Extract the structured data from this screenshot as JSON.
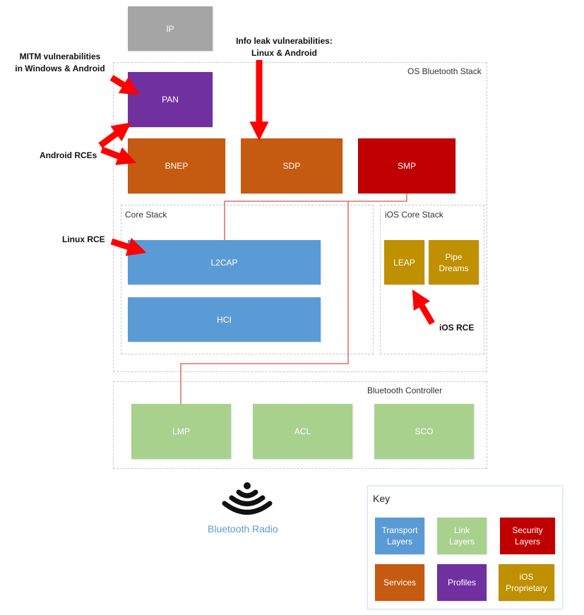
{
  "colors": {
    "transport": "#5b9bd5",
    "link": "#a9d18e",
    "security": "#c00000",
    "services": "#c55a11",
    "profiles": "#7030a0",
    "ios": "#bf9000",
    "other": "#a5a5a5",
    "arrow": "#ff0000"
  },
  "groups": {
    "os_stack": "OS Bluetooth Stack",
    "core_stack": "Core Stack",
    "ios_core_stack": "iOS Core Stack",
    "controller": "Bluetooth Controller"
  },
  "blocks": {
    "ip": "IP",
    "pan": "PAN",
    "bnep": "BNEP",
    "sdp": "SDP",
    "smp": "SMP",
    "l2cap": "L2CAP",
    "hci": "HCI",
    "leap": "LEAP",
    "pipe_dreams": "Pipe Dreams",
    "lmp": "LMP",
    "acl": "ACL",
    "sco": "SCO"
  },
  "annotations": {
    "mitm_line1": "MITM vulnerabilities",
    "mitm_line2": "in Windows & Android",
    "info_leak_line1": "Info leak vulnerabilities:",
    "info_leak_line2": "Linux & Android",
    "android_rce": "Android RCEs",
    "linux_rce": "Linux RCE",
    "ios_rce": "iOS RCE"
  },
  "radio": {
    "label": "Bluetooth Radio",
    "icon": "wireless-signal-icon"
  },
  "key": {
    "title": "Key",
    "items": [
      "Transport Layers",
      "Link Layers",
      "Security Layers",
      "Services",
      "Profiles",
      "iOS Proprietary"
    ]
  }
}
